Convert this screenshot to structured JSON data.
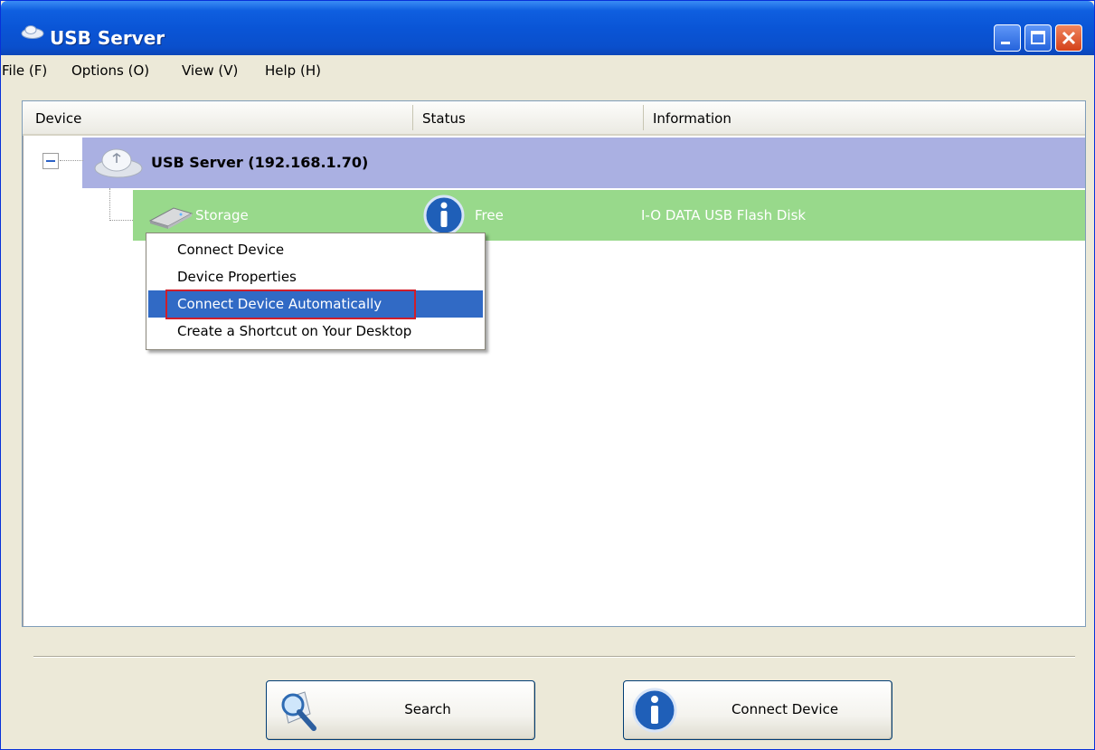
{
  "window": {
    "title": "USB Server"
  },
  "menu": [
    "File (F)",
    "Options (O)",
    "View (V)",
    "Help (H)"
  ],
  "columns": {
    "device": "Device",
    "status": "Status",
    "information": "Information"
  },
  "tree": {
    "server": {
      "label": "USB Server (192.168.1.70)"
    },
    "device": {
      "label": "Storage",
      "status": "Free",
      "information": "I-O DATA USB Flash Disk"
    }
  },
  "context_menu": {
    "items": [
      "Connect Device",
      "Device Properties",
      "Connect Device Automatically",
      "Create a Shortcut on Your Desktop"
    ],
    "selected_index": 2
  },
  "buttons": {
    "search": "Search",
    "connect": "Connect Device"
  },
  "colors": {
    "server_row": "#aab0e2",
    "device_row": "#98d98b",
    "selection": "#316ac5",
    "highlight_box": "#d01e2a"
  }
}
